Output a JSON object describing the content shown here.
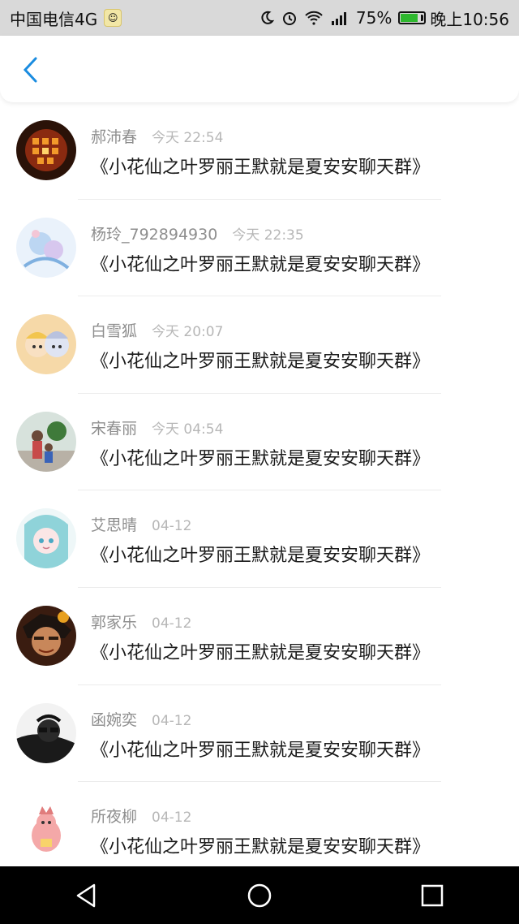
{
  "status_bar": {
    "carrier": "中国电信4G",
    "battery_percent": "75%",
    "battery_level": 0.75,
    "time": "晚上10:56",
    "icons": [
      "moon-icon",
      "alarm-icon",
      "wifi-icon",
      "signal-icon",
      "battery-icon"
    ]
  },
  "header": {
    "back_icon": "chevron-left-icon",
    "accent_color": "#1a8ce0"
  },
  "messages": [
    {
      "name": "郝沛春",
      "time": "今天 22:54",
      "text": "《小花仙之叶罗丽王默就是夏安安聊天群》"
    },
    {
      "name": "杨玲_792894930",
      "time": "今天 22:35",
      "text": "《小花仙之叶罗丽王默就是夏安安聊天群》"
    },
    {
      "name": "白雪狐",
      "time": "今天 20:07",
      "text": "《小花仙之叶罗丽王默就是夏安安聊天群》"
    },
    {
      "name": "宋春丽",
      "time": "今天 04:54",
      "text": "《小花仙之叶罗丽王默就是夏安安聊天群》"
    },
    {
      "name": "艾思晴",
      "time": "04-12",
      "text": "《小花仙之叶罗丽王默就是夏安安聊天群》"
    },
    {
      "name": "郭家乐",
      "time": "04-12",
      "text": "《小花仙之叶罗丽王默就是夏安安聊天群》"
    },
    {
      "name": "函婉奕",
      "time": "04-12",
      "text": "《小花仙之叶罗丽王默就是夏安安聊天群》"
    },
    {
      "name": "所夜柳",
      "time": "04-12",
      "text": "《小花仙之叶罗丽王默就是夏安安聊天群》"
    }
  ],
  "nav_bar": {
    "icons": [
      "back-triangle-icon",
      "home-circle-icon",
      "recents-square-icon"
    ]
  }
}
